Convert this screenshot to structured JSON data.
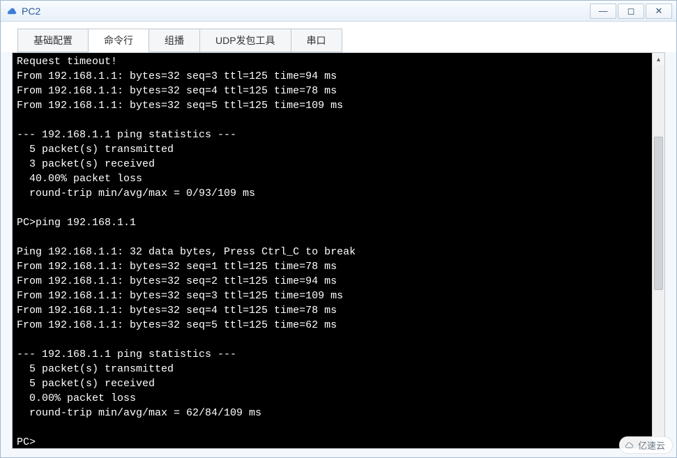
{
  "window": {
    "title": "PC2"
  },
  "tabs": {
    "items": [
      {
        "label": "基础配置"
      },
      {
        "label": "命令行"
      },
      {
        "label": "组播"
      },
      {
        "label": "UDP发包工具"
      },
      {
        "label": "串口"
      }
    ],
    "active_index": 1
  },
  "terminal": {
    "lines": [
      "Request timeout!",
      "From 192.168.1.1: bytes=32 seq=3 ttl=125 time=94 ms",
      "From 192.168.1.1: bytes=32 seq=4 ttl=125 time=78 ms",
      "From 192.168.1.1: bytes=32 seq=5 ttl=125 time=109 ms",
      "",
      "--- 192.168.1.1 ping statistics ---",
      "  5 packet(s) transmitted",
      "  3 packet(s) received",
      "  40.00% packet loss",
      "  round-trip min/avg/max = 0/93/109 ms",
      "",
      "PC>ping 192.168.1.1",
      "",
      "Ping 192.168.1.1: 32 data bytes, Press Ctrl_C to break",
      "From 192.168.1.1: bytes=32 seq=1 ttl=125 time=78 ms",
      "From 192.168.1.1: bytes=32 seq=2 ttl=125 time=94 ms",
      "From 192.168.1.1: bytes=32 seq=3 ttl=125 time=109 ms",
      "From 192.168.1.1: bytes=32 seq=4 ttl=125 time=78 ms",
      "From 192.168.1.1: bytes=32 seq=5 ttl=125 time=62 ms",
      "",
      "--- 192.168.1.1 ping statistics ---",
      "  5 packet(s) transmitted",
      "  5 packet(s) received",
      "  0.00% packet loss",
      "  round-trip min/avg/max = 62/84/109 ms",
      "",
      "PC>"
    ]
  },
  "watermark": {
    "text": "亿速云"
  },
  "win_controls": {
    "minimize": "—",
    "maximize": "◻",
    "close": "✕"
  }
}
